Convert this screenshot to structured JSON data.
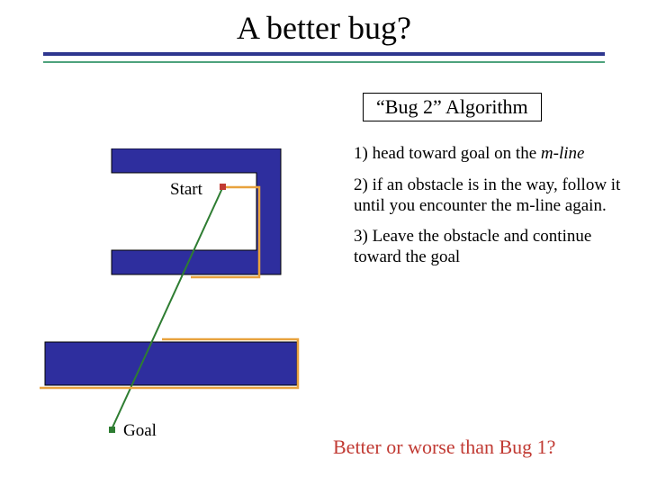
{
  "title": "A better bug?",
  "algorithm_label": "“Bug 2” Algorithm",
  "steps": {
    "s1_a": "1) head toward goal on the ",
    "s1_b": "m-line",
    "s2": "2) if an obstacle is in the way, follow it until you encounter the m-line again.",
    "s3": "3) Leave the obstacle and continue toward the goal"
  },
  "labels": {
    "start": "Start",
    "goal": "Goal"
  },
  "question": "Better or worse than Bug 1?"
}
